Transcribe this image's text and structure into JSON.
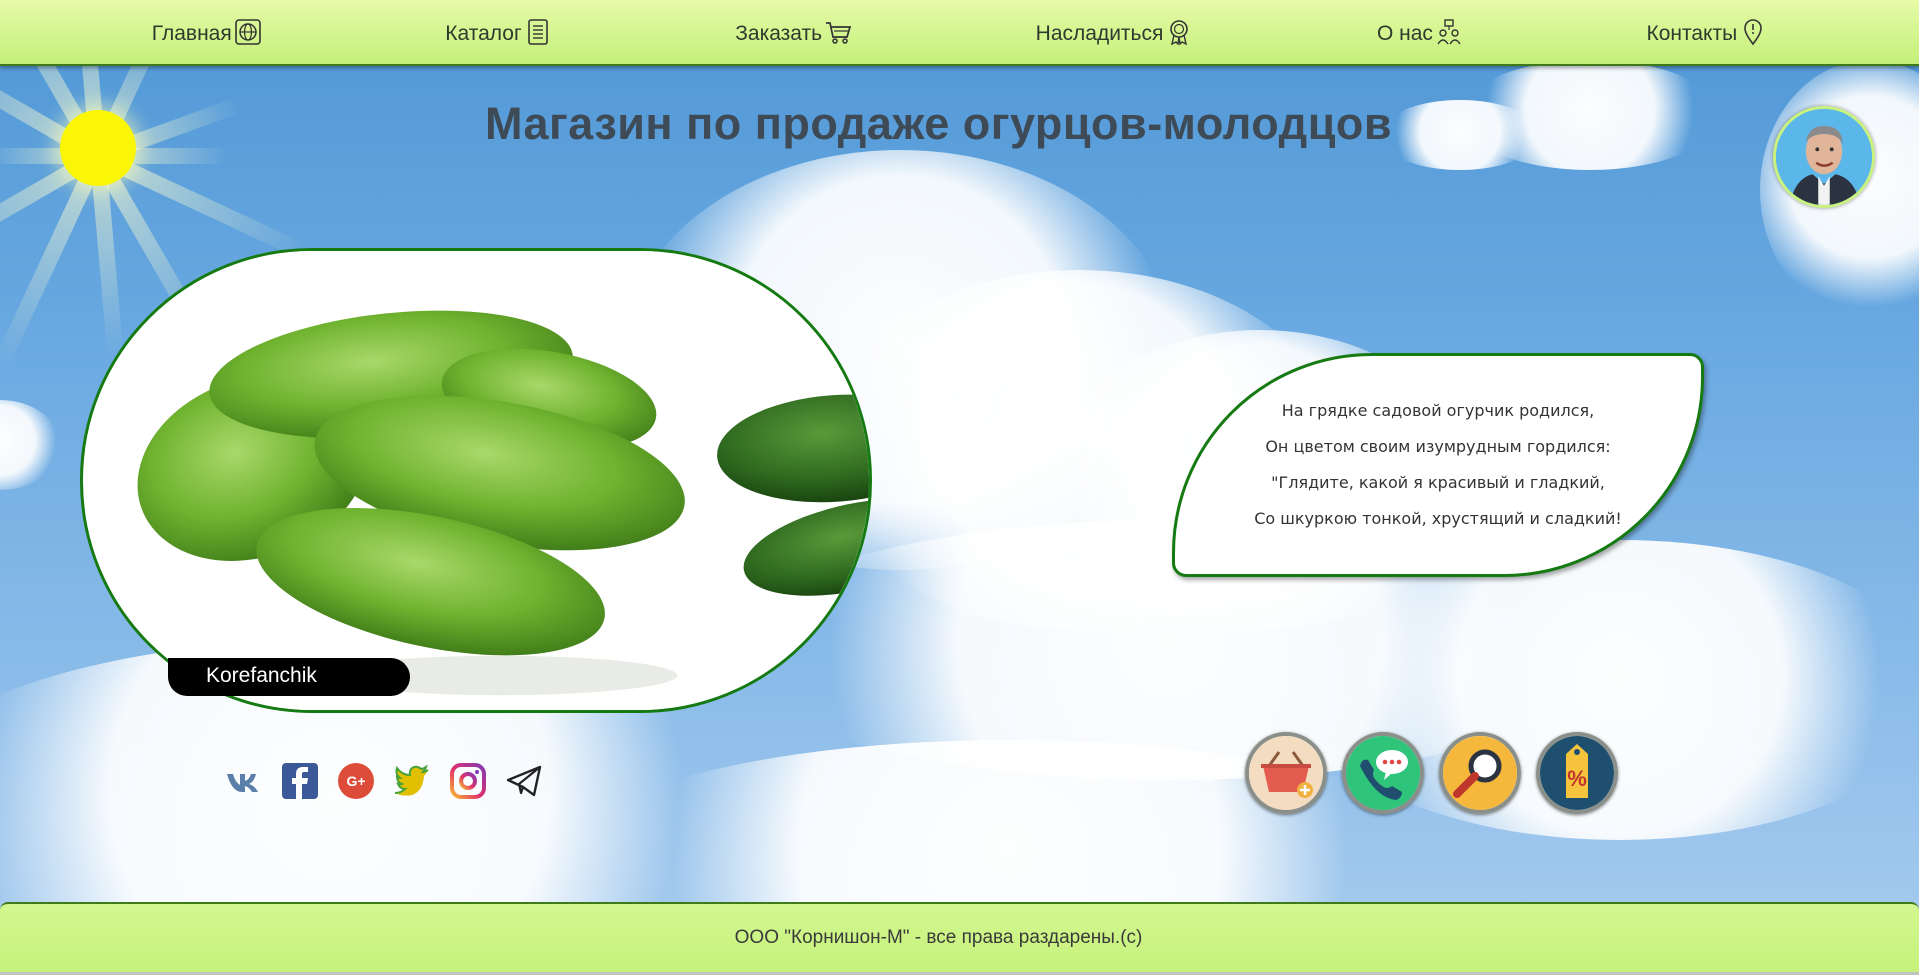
{
  "nav": {
    "items": [
      {
        "label": "Главная",
        "icon": "globe-icon"
      },
      {
        "label": "Каталог",
        "icon": "document-list-icon"
      },
      {
        "label": "Заказать",
        "icon": "cart-icon"
      },
      {
        "label": "Насладиться",
        "icon": "medal-icon"
      },
      {
        "label": "О нас",
        "icon": "team-icon"
      },
      {
        "label": "Контакты",
        "icon": "location-pin-icon"
      }
    ]
  },
  "page": {
    "title": "Магазин по продаже огурцов-молодцов"
  },
  "photo": {
    "caption": "Korefanchik"
  },
  "poem": {
    "lines": [
      "На грядке садовой огурчик родился,",
      "Он цветом своим изумрудным гордился:",
      "\"Глядите, какой я красивый и гладкий,",
      "Со шкуркою тонкой, хрустящий и сладкий!"
    ]
  },
  "social": [
    "vk-icon",
    "facebook-icon",
    "google-plus-icon",
    "twitter-icon",
    "instagram-icon",
    "telegram-icon"
  ],
  "actions": [
    "basket-add-icon",
    "phone-chat-icon",
    "magnifier-icon",
    "discount-tag-icon"
  ],
  "footer": {
    "text": "ООО \"Корнишон-М\" - все права раздарены.(с)"
  },
  "colors": {
    "nav_bg": "#d4f78c",
    "accent_green": "#167a12",
    "sun": "#fbf506"
  }
}
